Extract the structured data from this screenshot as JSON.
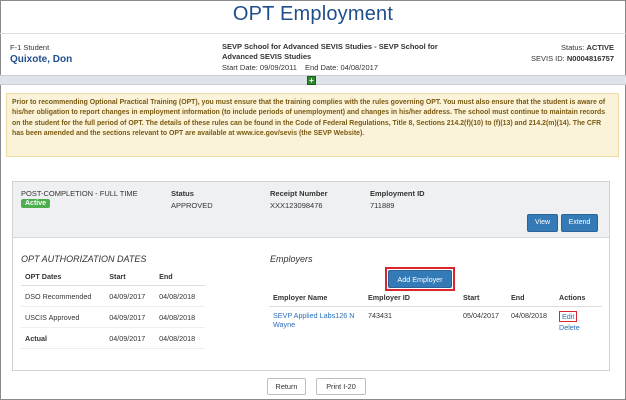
{
  "page": {
    "title": "OPT Employment"
  },
  "student": {
    "type": "F-1 Student",
    "name": "Quixote, Don",
    "school": "SEVP School for Advanced SEVIS Studies - SEVP School for Advanced SEVIS Studies",
    "start_date": "Start Date: 09/09/2011",
    "end_date": "End Date: 04/08/2017",
    "status_label": "Status:",
    "status_value": "ACTIVE",
    "sevis_label": "SEVIS ID:",
    "sevis_value": "N0004816757"
  },
  "expand_icon": "plus-icon",
  "warning_text": "Prior to recommending Optional Practical Training (OPT), you must ensure that the training complies with the rules governing OPT. You must also ensure that the student is aware of his/her obligation to report changes in employment information (to include periods of unemployment) and changes in his/her address. The school must continue to maintain records on the student for the full period of OPT. The details of these rules can be found in the Code of Federal Regulations, Title 8, Sections 214.2(f)(10) to (f)(13) and 214.2(m)(14). The CFR has been amended and the sections relevant to OPT are available at www.ice.gov/sevis (the SEVP Website).",
  "opt": {
    "type_label": "POST-COMPLETION - FULL TIME",
    "badge": "Active",
    "status_header": "Status",
    "status_value": "APPROVED",
    "receipt_header": "Receipt Number",
    "receipt_value": "XXX123098476",
    "employment_id_header": "Employment ID",
    "employment_id_value": "711889",
    "view_button": "View",
    "extend_button": "Extend"
  },
  "authorization": {
    "heading": "OPT AUTHORIZATION DATES",
    "columns": [
      "OPT Dates",
      "Start",
      "End"
    ],
    "rows": [
      [
        "DSO Recommended",
        "04/09/2017",
        "04/08/2018"
      ],
      [
        "USCIS Approved",
        "04/09/2017",
        "04/08/2018"
      ],
      [
        "Actual",
        "04/09/2017",
        "04/08/2018"
      ]
    ]
  },
  "employers": {
    "heading": "Employers",
    "add_button": "Add Employer",
    "columns": [
      "Employer Name",
      "Employer ID",
      "Start",
      "End",
      "Actions"
    ],
    "rows": [
      {
        "name": "SEVP Applied Labs126 N Wayne",
        "id": "743431",
        "start": "05/04/2017",
        "end": "04/08/2018",
        "edit": "Edit",
        "delete": "Delete"
      }
    ]
  },
  "footer": {
    "return_button": "Return",
    "print_button": "Print I-20"
  },
  "colors": {
    "title_blue": "#1f4e8c",
    "primary_button": "#337ab7",
    "active_green": "#4cae4c",
    "highlight_red": "#d9262c",
    "warning_bg": "#fbf3d9"
  }
}
